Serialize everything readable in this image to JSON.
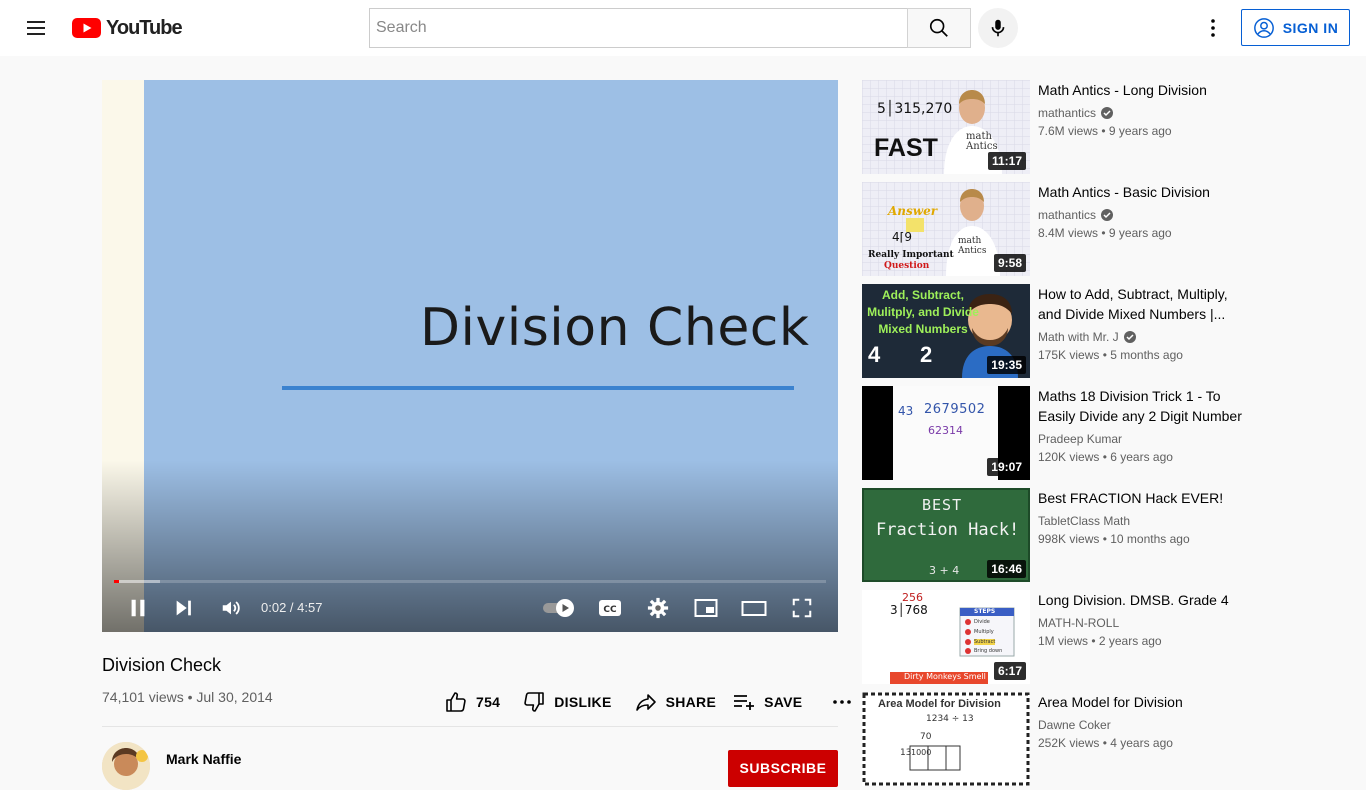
{
  "header": {
    "logo_text": "YouTube",
    "search_placeholder": "Search",
    "signin_label": "SIGN IN",
    "brand_red": "#ff0000",
    "accent_blue": "#065fd4"
  },
  "player": {
    "slide_title": "Division Check",
    "time": "0:02 / 4:57",
    "progress_fraction": 0.007,
    "buffered_fraction": 0.065,
    "state": "playing"
  },
  "video": {
    "title": "Division Check",
    "meta": "74,101 views • Jul 30, 2014",
    "likes": "754",
    "dislike_label": "DISLIKE",
    "share_label": "SHARE",
    "save_label": "SAVE",
    "owner_name": "Mark Naffie",
    "subscribe_label": "SUBSCRIBE"
  },
  "recommendations": [
    {
      "title": "Math Antics - Long Division",
      "channel": "mathantics",
      "verified": true,
      "stats": "7.6M views • 9 years ago",
      "duration": "11:17",
      "thumb_text_1": "5│315,270",
      "thumb_text_2": "FAST",
      "thumb_shirt": "math Antics"
    },
    {
      "title": "Math Antics - Basic Division",
      "channel": "mathantics",
      "verified": true,
      "stats": "8.4M views • 9 years ago",
      "duration": "9:58",
      "thumb_text_1": "Answer",
      "thumb_text_2": "4⌈9",
      "thumb_text_3": "Really Important",
      "thumb_text_4": "Question",
      "thumb_shirt": "math Antics"
    },
    {
      "title": "How to Add, Subtract, Multiply, and Divide Mixed Numbers |...",
      "channel": "Math with Mr. J",
      "verified": true,
      "stats": "175K views • 5 months ago",
      "duration": "19:35",
      "thumb_text_1": "Add, Subtract, Mulitply, and Divide Mixed Numbers",
      "thumb_text_2": "4",
      "thumb_text_3": "2"
    },
    {
      "title": "Maths 18 Division Trick 1 - To Easily Divide any 2 Digit Number",
      "channel": "Pradeep Kumar",
      "verified": false,
      "stats": "120K views • 6 years ago",
      "duration": "19:07",
      "thumb_text_1": "43",
      "thumb_text_2": "2679502",
      "thumb_text_3": "62314"
    },
    {
      "title": "Best FRACTION Hack EVER!",
      "channel": "TabletClass Math",
      "verified": false,
      "stats": "998K views • 10 months ago",
      "duration": "16:46",
      "thumb_text_1": "BEST",
      "thumb_text_2": "Fraction Hack!"
    },
    {
      "title": "Long Division. DMSB. Grade 4",
      "channel": "MATH-N-ROLL",
      "verified": false,
      "stats": "1M views • 2 years ago",
      "duration": "6:17",
      "thumb_text_1": "256",
      "thumb_text_2": "3│768",
      "thumb_text_3": "STEPS",
      "thumb_text_4": "Dirty Monkeys Smell Bad",
      "steps": [
        "Divide",
        "Multiply",
        "Subtract",
        "Bring down"
      ]
    },
    {
      "title": "Area Model for Division",
      "channel": "Dawne Coker",
      "verified": false,
      "stats": "252K views • 4 years ago",
      "duration": "",
      "thumb_text_1": "Area Model for Division",
      "thumb_text_2": "1234 ÷ 13",
      "thumb_text_3": "70",
      "thumb_text_4": "13",
      "thumb_text_5": "1000"
    }
  ]
}
